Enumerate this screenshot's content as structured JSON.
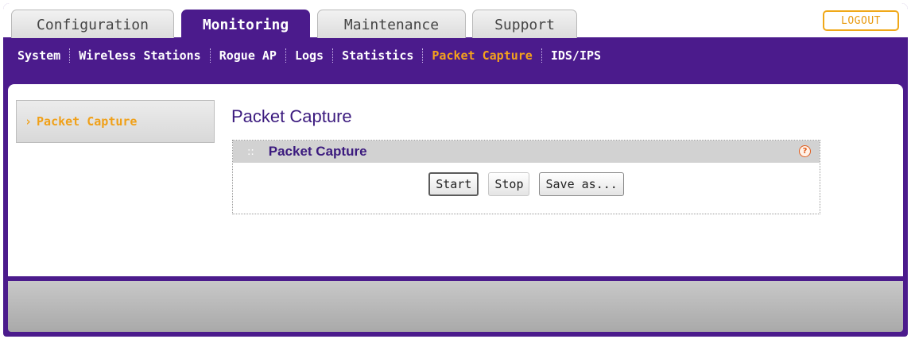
{
  "tabs": [
    {
      "label": "Configuration"
    },
    {
      "label": "Monitoring"
    },
    {
      "label": "Maintenance"
    },
    {
      "label": "Support"
    }
  ],
  "active_tab": "Monitoring",
  "logout_label": "LOGOUT",
  "submenu": [
    {
      "label": "System"
    },
    {
      "label": "Wireless Stations"
    },
    {
      "label": "Rogue AP"
    },
    {
      "label": "Logs"
    },
    {
      "label": "Statistics"
    },
    {
      "label": "Packet Capture"
    },
    {
      "label": "IDS/IPS"
    }
  ],
  "active_submenu": "Packet Capture",
  "sidebar": {
    "items": [
      {
        "label": "Packet Capture",
        "icon": "chevron-right-icon"
      }
    ]
  },
  "page": {
    "title": "Packet Capture"
  },
  "box": {
    "title": "Packet Capture",
    "help_icon": "?",
    "buttons": {
      "start": "Start",
      "stop": "Stop",
      "save": "Save as..."
    }
  },
  "colors": {
    "brand_purple": "#4b1b8c",
    "accent_orange": "#f5a21c",
    "title_purple": "#3b1a7e"
  }
}
